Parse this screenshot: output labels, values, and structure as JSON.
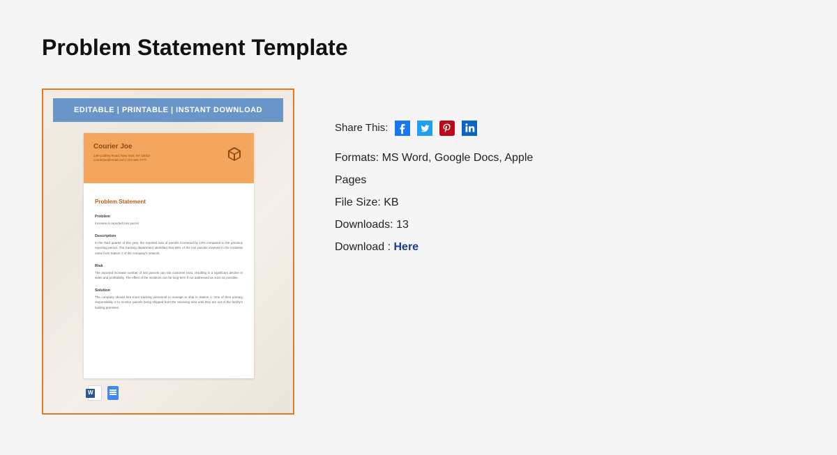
{
  "title": "Problem Statement Template",
  "share": {
    "label": "Share This:"
  },
  "meta": {
    "formats_label": "Formats:",
    "formats_value": "MS Word, Google Docs, Apple Pages",
    "filesize_label": "File Size:",
    "filesize_value": "KB",
    "downloads_label": "Downloads:",
    "downloads_value": "13",
    "download_label": "Download :",
    "download_link_text": "Here"
  },
  "preview": {
    "banner": "EDITABLE  |  PRINTABLE  |  INSTANT DOWNLOAD",
    "company": "Courier Joe",
    "address_line1": "139 Godfrey Road, New York, NY 10013",
    "address_line2": "courierjoe@email.com | 222 555 7777",
    "heading": "Problem Statement",
    "sections": {
      "problem_h": "Problem",
      "problem_p": "Increase in reported loss parcel",
      "description_h": "Description",
      "description_p": "In the third quarter of this year, the reported loss of parcels increased by 13% compared to the previous reporting period. The tracking department identified that 95% of the lost parcels involved in the incidents came from Station 1 of the company's network.",
      "risk_h": "Risk",
      "risk_p": "The reported increase number of lost parcels can risk customer trust, resulting in a significant decline in sales and profitability. The effect of the incidents can be long-term if not addressed as soon as possible.",
      "solution_h": "Solution",
      "solution_p": "The company should hire more tracking personnel to manage to ship in Station 1. One of their primary responsibility is to monitor parcels being shipped from the receiving area until they are out of the facility's holding premises."
    }
  }
}
